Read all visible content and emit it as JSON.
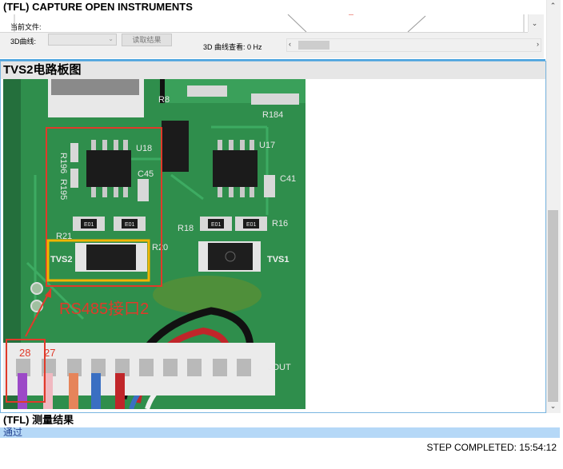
{
  "top": {
    "title": "(TFL) CAPTURE OPEN INSTRUMENTS",
    "current_file_label": "当前文件:",
    "curve_label": "3D曲线:",
    "curve_select_value": "",
    "read_button_label": "读取结果",
    "curve_view_label": "3D 曲线查看: 0 Hz"
  },
  "circuit": {
    "title": "TVS2电路板图",
    "labels": {
      "r21": "R21",
      "r20": "R20",
      "r18": "R18",
      "r16": "R16",
      "r8": "R8",
      "r184": "R184",
      "r196": "R196",
      "r195": "R195",
      "u18": "U18",
      "u17": "U17",
      "c45": "C45",
      "c41": "C41",
      "e01a": "E01",
      "e01b": "E01",
      "e01c": "E01",
      "e01d": "E01",
      "tvs2": "TVS2",
      "tvs1": "TVS1",
      "jout": "JOUT",
      "rs485": "RS485接口2",
      "pin28": "28",
      "pin27": "27"
    }
  },
  "result": {
    "title": "(TFL) 测量结果",
    "value": "通过",
    "status": "STEP COMPLETED: 15:54:12"
  },
  "colors": {
    "accent": "#4aa3df",
    "highlight_red": "#e03a2a",
    "highlight_yellow": "#f2b400",
    "pcb_green": "#2f8e4c",
    "result_bar": "#b5d8f7"
  }
}
